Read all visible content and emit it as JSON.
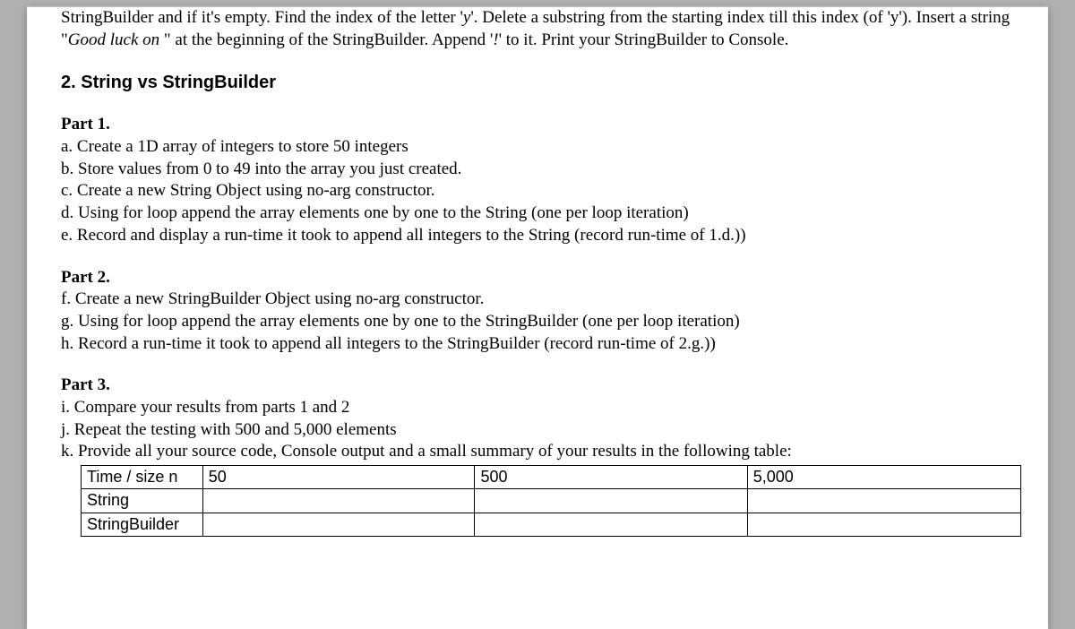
{
  "intro_para": "StringBuilder and if it's empty. Find the index of the letter 'y'. Delete a substring from the starting index till this index (of 'y'). Insert a string \"Good luck on \" at the beginning of the StringBuilder. Append '!' to it. Print your StringBuilder to Console.",
  "section2_title": "2. String vs StringBuilder",
  "part1": {
    "heading": "Part 1.",
    "a": "a. Create a 1D array of integers to store 50 integers",
    "b": "b. Store values from 0 to 49 into the array you just created.",
    "c": "c. Create a new String Object using no-arg constructor.",
    "d": "d. Using for loop append the array elements one by one to the String (one per loop iteration)",
    "e": "e. Record and display a run-time it took to append all integers to the String (record run-time of 1.d.))"
  },
  "part2": {
    "heading": "Part 2.",
    "f": "f. Create a new StringBuilder Object using no-arg constructor.",
    "g": "g. Using for loop append the array elements one by one to the StringBuilder (one per loop iteration)",
    "h": "h. Record a run-time it took to append all integers to the StringBuilder (record run-time of 2.g.))"
  },
  "part3": {
    "heading": "Part 3.",
    "i": "i. Compare your results from parts 1 and 2",
    "j": "j. Repeat the testing with 500 and 5,000 elements",
    "k": "k. Provide all your source code, Console output and a small summary of your results in the following table:"
  },
  "table": {
    "header": [
      "Time / size n",
      "50",
      "500",
      "5,000"
    ],
    "rows": [
      [
        "String",
        "",
        "",
        ""
      ],
      [
        "StringBuilder",
        "",
        "",
        ""
      ]
    ]
  }
}
